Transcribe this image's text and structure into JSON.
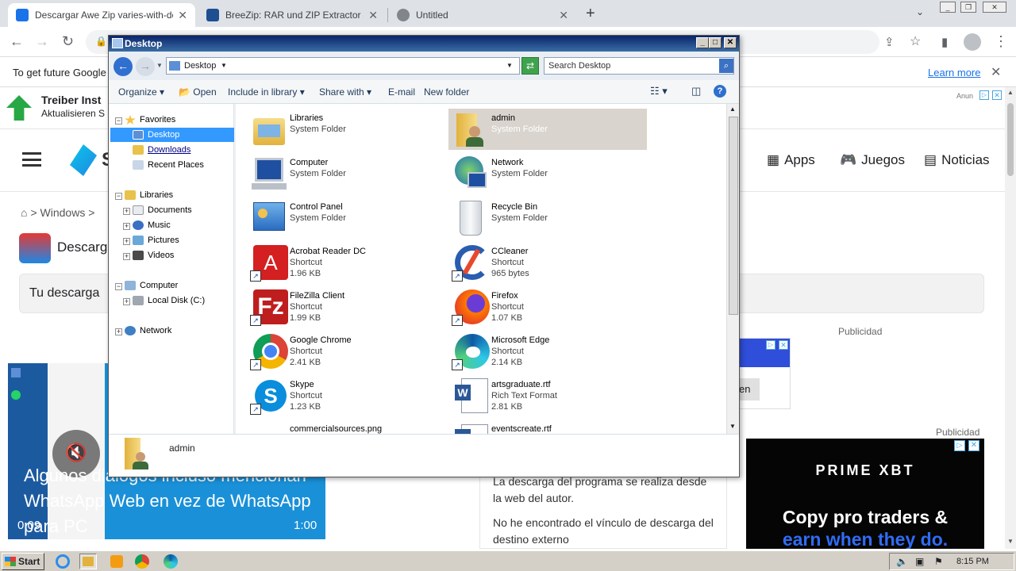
{
  "browser": {
    "tabs": [
      {
        "title": "Descargar Awe Zip varies-with-devic",
        "active": true
      },
      {
        "title": "BreeZip: RAR und ZIP Extractor – Mi",
        "active": false
      },
      {
        "title": "Untitled",
        "active": false
      }
    ],
    "infobar": {
      "message": "To get future Google",
      "learn_more": "Learn more"
    }
  },
  "webpage": {
    "ad_title": "Treiber Inst",
    "ad_subtitle": "Aktualisieren S",
    "ad_label": "Anun",
    "logo_letter": "S",
    "nav": {
      "apps": "Apps",
      "juegos": "Juegos",
      "noticias": "Noticias"
    },
    "breadcrumb": "> Windows >",
    "page_title": "Descarg",
    "download_box": "Tu descarga",
    "publicidad_1": "Publicidad",
    "publicidad_2": "Publicidad",
    "ad_button": "en",
    "body_text_1": "La descarga del programa se realiza desde la web del autor.",
    "body_text_2": "No he encontrado el vínculo de descarga del destino externo",
    "prime_ad": {
      "brand": "PRIME XBT",
      "line1": "Copy pro traders &",
      "line2": "earn when they do."
    }
  },
  "video": {
    "caption": "Algunos diálogos incluso mencionan WhatsApp Web en vez de WhatsApp para PC",
    "time_current": "0:09",
    "time_total": "1:00"
  },
  "explorer": {
    "title": "Desktop",
    "address": "Desktop",
    "search_placeholder": "Search Desktop",
    "commands": {
      "organize": "Organize",
      "open": "Open",
      "include": "Include in library",
      "share": "Share with",
      "email": "E-mail",
      "new_folder": "New folder"
    },
    "nav": {
      "favorites": "Favorites",
      "desktop": "Desktop",
      "downloads": "Downloads",
      "recent": "Recent Places",
      "libraries": "Libraries",
      "documents": "Documents",
      "music": "Music",
      "pictures": "Pictures",
      "videos": "Videos",
      "computer": "Computer",
      "local_disk": "Local Disk (C:)",
      "network": "Network"
    },
    "files": [
      {
        "name": "Libraries",
        "type": "System Folder",
        "size": "",
        "icon": "libraries-icon"
      },
      {
        "name": "admin",
        "type": "System Folder",
        "size": "",
        "icon": "user-folder-icon"
      },
      {
        "name": "Computer",
        "type": "System Folder",
        "size": "",
        "icon": "computer-icon"
      },
      {
        "name": "Network",
        "type": "System Folder",
        "size": "",
        "icon": "network-icon"
      },
      {
        "name": "Control Panel",
        "type": "System Folder",
        "size": "",
        "icon": "control-panel-icon"
      },
      {
        "name": "Recycle Bin",
        "type": "System Folder",
        "size": "",
        "icon": "recycle-bin-icon"
      },
      {
        "name": "Acrobat Reader DC",
        "type": "Shortcut",
        "size": "1.96 KB",
        "icon": "acrobat-icon"
      },
      {
        "name": "CCleaner",
        "type": "Shortcut",
        "size": "965 bytes",
        "icon": "ccleaner-icon"
      },
      {
        "name": "FileZilla Client",
        "type": "Shortcut",
        "size": "1.99 KB",
        "icon": "filezilla-icon"
      },
      {
        "name": "Firefox",
        "type": "Shortcut",
        "size": "1.07 KB",
        "icon": "firefox-icon"
      },
      {
        "name": "Google Chrome",
        "type": "Shortcut",
        "size": "2.41 KB",
        "icon": "chrome-icon"
      },
      {
        "name": "Microsoft Edge",
        "type": "Shortcut",
        "size": "2.14 KB",
        "icon": "edge-icon"
      },
      {
        "name": "Skype",
        "type": "Shortcut",
        "size": "1.23 KB",
        "icon": "skype-icon"
      },
      {
        "name": "artsgraduate.rtf",
        "type": "Rich Text Format",
        "size": "2.81 KB",
        "icon": "word-doc-icon"
      },
      {
        "name": "commercialsources.png",
        "type": "",
        "size": "",
        "icon": "image-icon"
      },
      {
        "name": "eventscreate.rtf",
        "type": "",
        "size": "",
        "icon": "word-doc-icon"
      }
    ],
    "details": {
      "name": "admin"
    }
  },
  "taskbar": {
    "start": "Start",
    "clock": "8:15 PM"
  }
}
